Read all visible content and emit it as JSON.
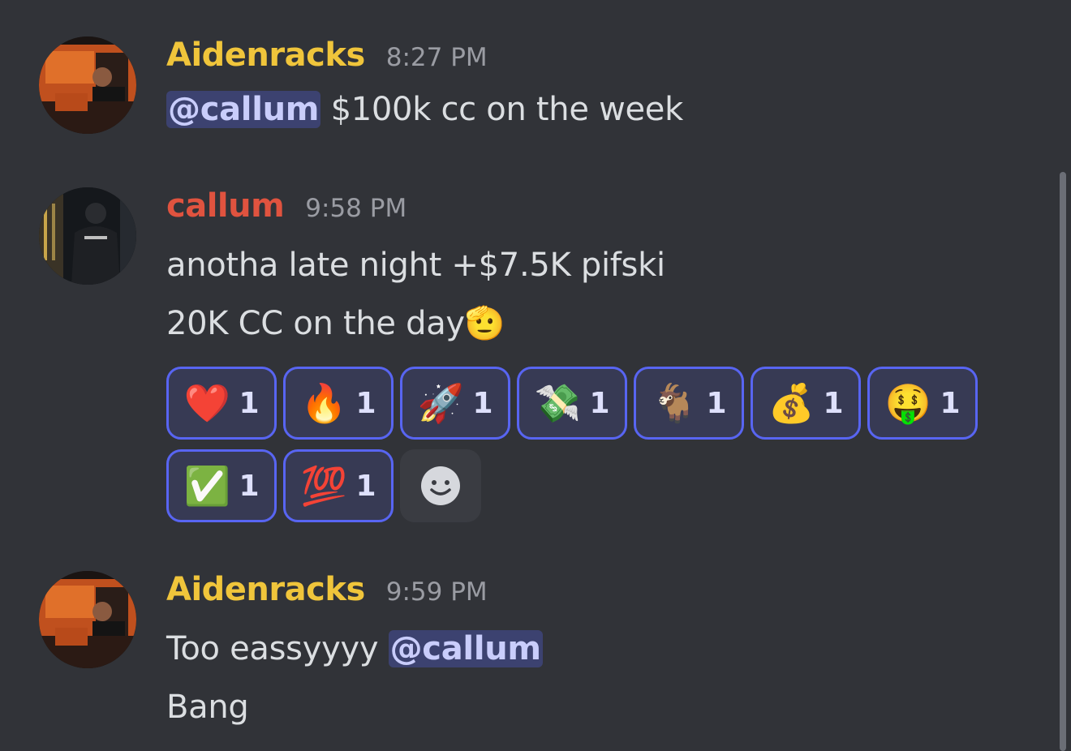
{
  "messages": [
    {
      "username": "Aidenracks",
      "username_color": "#f0c53b",
      "timestamp": "8:27 PM",
      "lines": [
        {
          "mention": "@callum",
          "text": " $100k cc on the week"
        }
      ]
    },
    {
      "username": "callum",
      "username_color": "#e0533f",
      "timestamp": "9:58 PM",
      "lines": [
        {
          "text": "anotha late night +$7.5K pifski"
        },
        {
          "text": "20K CC on the day",
          "emoji": "🫡"
        }
      ],
      "reactions": [
        {
          "emoji": "❤️",
          "icon": "red-heart-icon",
          "count": "1"
        },
        {
          "emoji": "🔥",
          "icon": "fire-icon",
          "count": "1"
        },
        {
          "emoji": "🚀",
          "icon": "rocket-icon",
          "count": "1"
        },
        {
          "emoji": "💸",
          "icon": "money-with-wings-icon",
          "count": "1"
        },
        {
          "emoji": "🐐",
          "icon": "goat-icon",
          "count": "1"
        },
        {
          "emoji": "💰",
          "icon": "money-bag-icon",
          "count": "1"
        },
        {
          "emoji": "🤑",
          "icon": "money-mouth-face-icon",
          "count": "1"
        },
        {
          "emoji": "✅",
          "icon": "check-mark-icon",
          "count": "1"
        },
        {
          "emoji": "💯",
          "icon": "hundred-points-icon",
          "count": "1"
        }
      ]
    },
    {
      "username": "Aidenracks",
      "username_color": "#f0c53b",
      "timestamp": "9:59 PM",
      "lines": [
        {
          "text": "Too eassyyyy ",
          "mention": "@callum"
        },
        {
          "text": "Bang"
        }
      ]
    }
  ],
  "colors": {
    "background": "#313338",
    "mention_bg": "#3c4270",
    "mention_text": "#c9cdfb",
    "reaction_border": "#5865f2"
  }
}
